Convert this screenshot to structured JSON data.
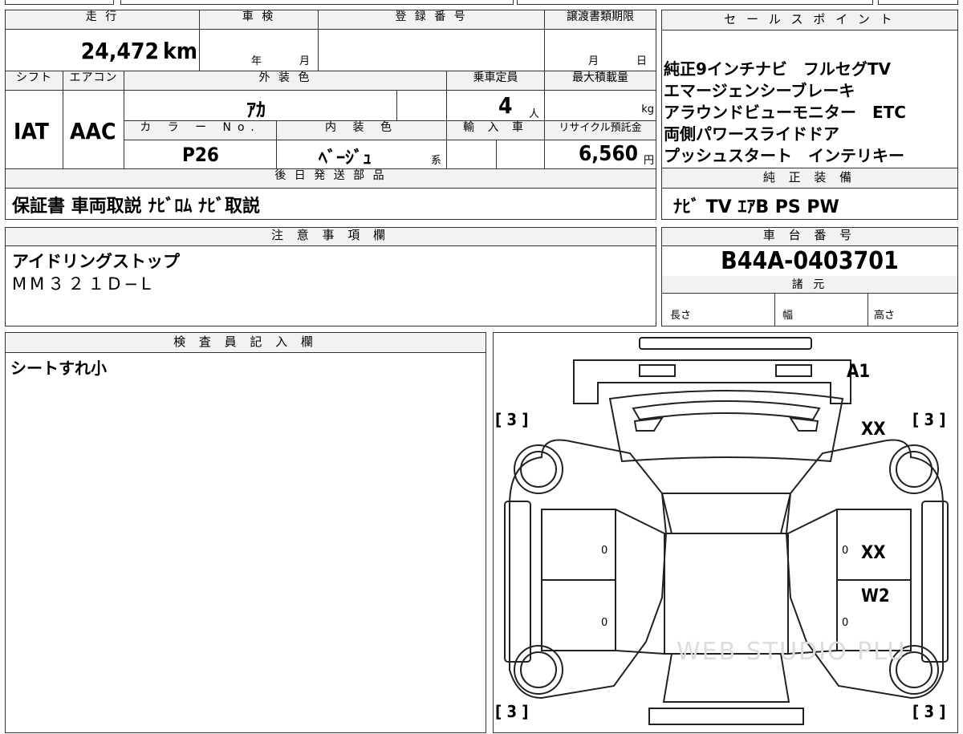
{
  "mileage": {
    "label": "走 行",
    "value": "24,472",
    "unit": "km"
  },
  "inspection": {
    "label": "車 検",
    "year": "年",
    "month": "月"
  },
  "registration": {
    "label": "登 録 番 号"
  },
  "transfer": {
    "label": "譲渡書類期限",
    "month": "月",
    "day": "日"
  },
  "sales_points": {
    "label": "セ ー ル ス ポ イ ン ト",
    "lines": [
      "純正9インチナビ　フルセグTV",
      "エマージェンシーブレーキ",
      "アラウンドビューモニター　ETC",
      "両側パワースライドドア",
      "プッシュスタート　インテリキー"
    ]
  },
  "shift": {
    "label": "シフト",
    "value": "IAT"
  },
  "aircon": {
    "label": "エアコン",
    "value": "AAC"
  },
  "exterior": {
    "label": "外 装 色",
    "value": "ｱｶ"
  },
  "capacity": {
    "label": "乗車定員",
    "value": "4",
    "unit": "人"
  },
  "max_load": {
    "label": "最大積載量",
    "unit": "kg"
  },
  "color_no": {
    "label": "カ ラ ー No.",
    "value": "P26"
  },
  "interior": {
    "label": "内 装 色",
    "value": "ﾍﾞｰｼﾞｭ",
    "suffix": "系"
  },
  "import": {
    "label": "輸 入 車"
  },
  "recycle": {
    "label": "リサイクル預託金",
    "value": "6,560",
    "unit": "円"
  },
  "later_parts": {
    "label": "後 日 発 送 部 品",
    "value": "保証書 車両取説 ﾅﾋﾞﾛﾑ ﾅﾋﾞ取説"
  },
  "equipment": {
    "label": "純 正 装 備",
    "value": "ﾅﾋﾞ TV ｴｱB PS PW"
  },
  "notes": {
    "label": "注 意 事 項 欄",
    "lines": [
      "アイドリングストップ",
      "MM３２１D−L"
    ]
  },
  "chassis": {
    "label": "車 台 番 号",
    "value": "B44A-0403701"
  },
  "specs": {
    "label": "諸 元",
    "length": "長さ",
    "width": "幅",
    "height": "高さ"
  },
  "inspector": {
    "label": "検 査 員 記 入 欄",
    "value": "シートすれ小"
  },
  "diagram": {
    "marks": {
      "a1": "A1",
      "xx_front": "XX",
      "xx_side": "XX",
      "w2": "W2"
    },
    "tire_labels": [
      "[ 3 ]",
      "[ 3 ]",
      "[ 3 ]",
      "[ 3 ]"
    ],
    "zeros": [
      "0",
      "0",
      "0",
      "0"
    ],
    "watermark": "WEB STUDIO PLU"
  }
}
